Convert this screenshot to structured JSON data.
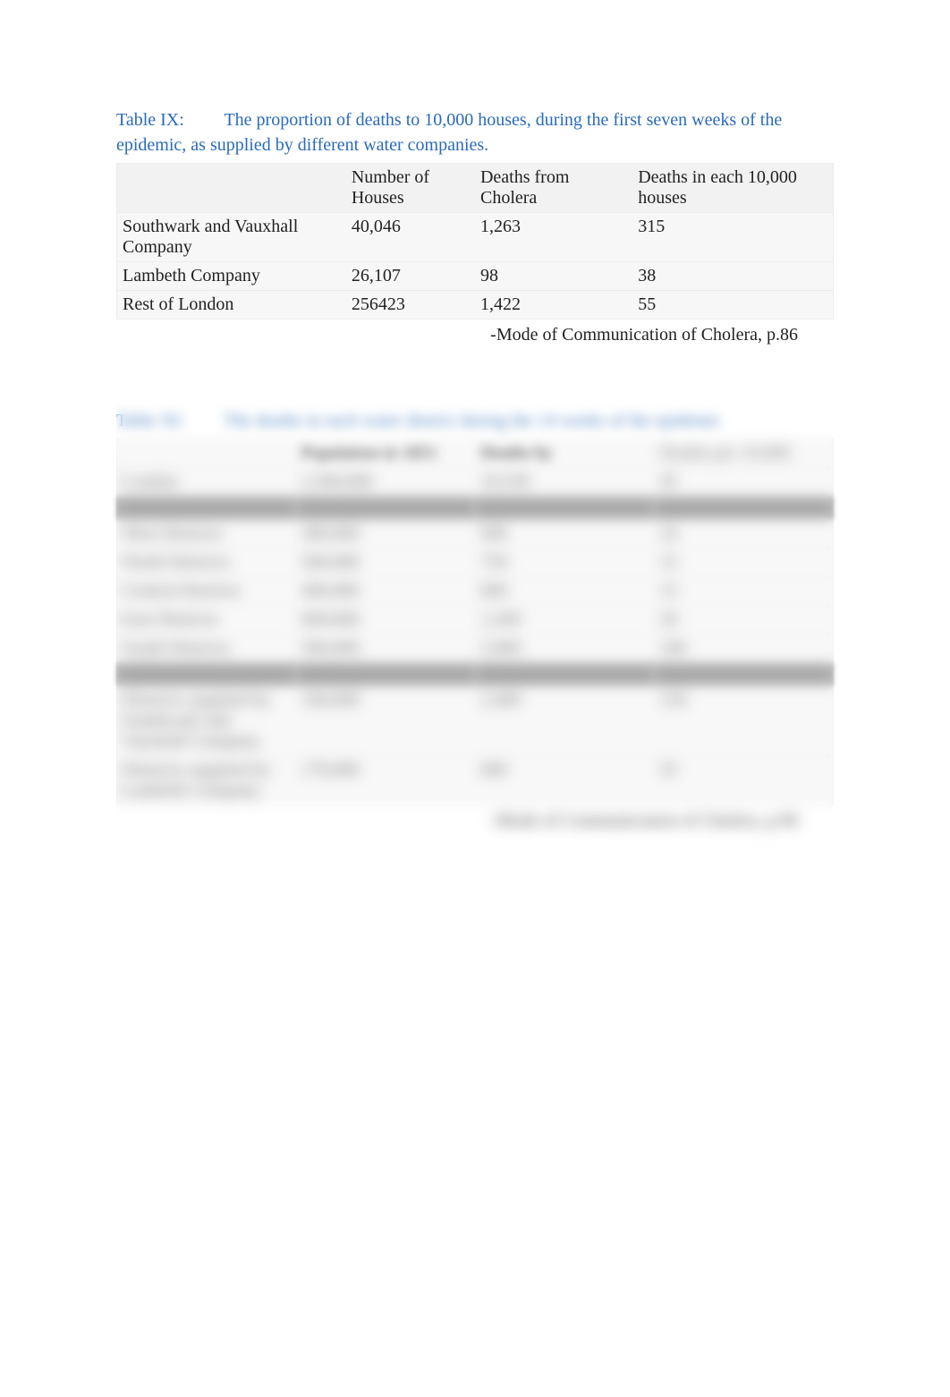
{
  "table9": {
    "caption_num": "Table IX:",
    "caption_text": "The proportion of deaths to 10,000 houses, during the first seven weeks of the epidemic, as supplied by different water companies.",
    "headers": {
      "c1": "",
      "c2": "Number of Houses",
      "c3": "Deaths from Cholera",
      "c4": "Deaths in each 10,000 houses"
    },
    "rows": [
      {
        "c1": "Southwark and Vauxhall Company",
        "c2": "40,046",
        "c3": "1,263",
        "c4": "315"
      },
      {
        "c1": "Lambeth Company",
        "c2": "26,107",
        "c3": "98",
        "c4": "38"
      },
      {
        "c1": "Rest of London",
        "c2": "256423",
        "c3": "1,422",
        "c4": "55"
      }
    ],
    "citation": "-Mode of Communication of Cholera, p.86"
  },
  "table11": {
    "caption_num": "Table XI:",
    "caption_text": "The deaths in each water district during the 14 weeks of the epidemic",
    "headers": {
      "c1": "",
      "c2": "Population in 1851",
      "c3": "Deaths by",
      "c4_obscured": "Deaths per 10,000"
    },
    "citation_obscured": "-Mode of Communication of Cholera, p.90"
  },
  "chart_data": [
    {
      "type": "table",
      "title": "Table IX: The proportion of deaths to 10,000 houses, during the first seven weeks of the epidemic, as supplied by different water companies.",
      "columns": [
        "",
        "Number of Houses",
        "Deaths from Cholera",
        "Deaths in each 10,000 houses"
      ],
      "rows": [
        [
          "Southwark and Vauxhall Company",
          40046,
          1263,
          315
        ],
        [
          "Lambeth Company",
          26107,
          98,
          38
        ],
        [
          "Rest of London",
          256423,
          1422,
          55
        ]
      ],
      "source": "Mode of Communication of Cholera, p.86"
    },
    {
      "type": "table",
      "title": "Table XI: The deaths in each water district during the 14 weeks of the epidemic",
      "columns": [
        "",
        "Population in 1851",
        "Deaths by",
        "(obscured)"
      ],
      "rows": [],
      "note": "Body of this table is blurred / not legible in the source image."
    }
  ]
}
